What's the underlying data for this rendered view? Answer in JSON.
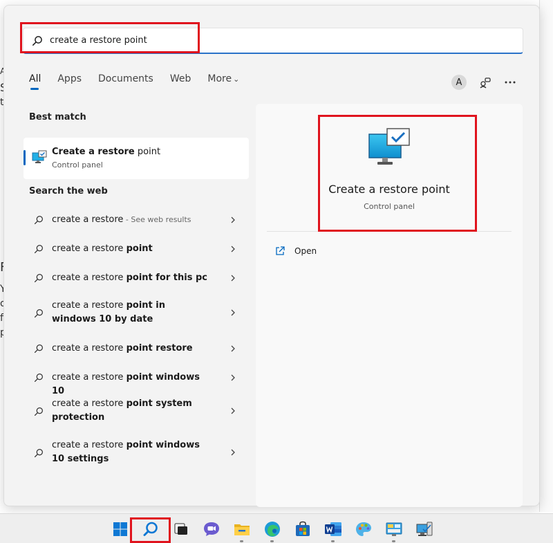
{
  "search": {
    "query": "create a restore point"
  },
  "tabs": [
    {
      "label": "All"
    },
    {
      "label": "Apps"
    },
    {
      "label": "Documents"
    },
    {
      "label": "Web"
    },
    {
      "label": "More"
    }
  ],
  "account_initial": "A",
  "best_match": {
    "label": "Best match",
    "title_bold": "Create a restore",
    "title_rest": " point",
    "subtitle": "Control panel"
  },
  "web_section": {
    "label": "Search the web",
    "items": [
      {
        "plain": "create a restore",
        "bold": "",
        "suffix": " - See web results"
      },
      {
        "plain": "create a restore ",
        "bold": "point",
        "suffix": ""
      },
      {
        "plain": "create a restore ",
        "bold": "point for this pc",
        "suffix": ""
      },
      {
        "plain": "create a restore ",
        "bold": "point in windows 10 by date",
        "suffix": ""
      },
      {
        "plain": "create a restore ",
        "bold": "point restore",
        "suffix": ""
      },
      {
        "plain": "create a restore ",
        "bold": "point windows 10",
        "suffix": ""
      },
      {
        "plain": "create a restore ",
        "bold": "point system protection",
        "suffix": ""
      },
      {
        "plain": "create a restore ",
        "bold": "point windows 10 settings",
        "suffix": ""
      }
    ]
  },
  "detail": {
    "title": "Create a restore point",
    "subtitle": "Control panel",
    "open_label": "Open"
  },
  "background_fragments": [
    "A",
    "S",
    "tl",
    "F",
    "Y",
    "o",
    "fi",
    "p"
  ],
  "colors": {
    "accent": "#0067c0",
    "highlight": "#e0141e"
  }
}
